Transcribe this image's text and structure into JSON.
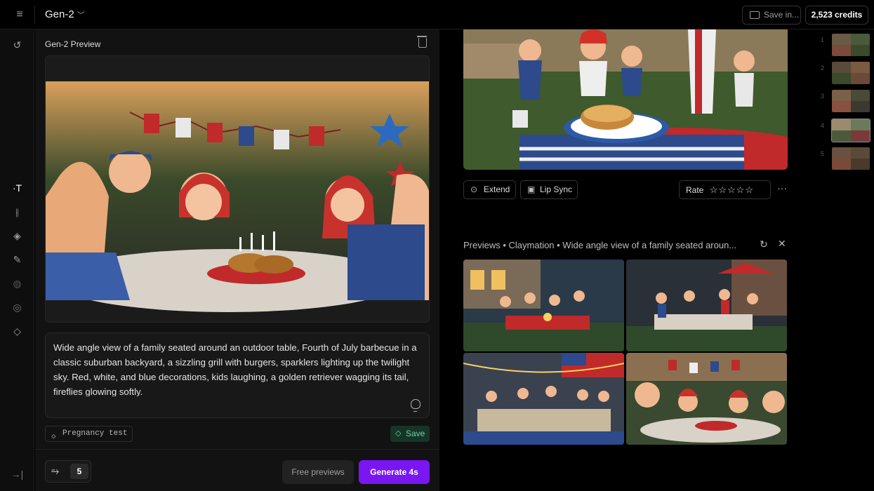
{
  "topbar": {
    "menu_icon": "menu-icon",
    "title": "Gen-2",
    "save_in": "Save in...",
    "credits": "2,523 credits"
  },
  "rail": {
    "icons": [
      "refresh-icon",
      "text-icon",
      "sliders-icon",
      "motion-brush-icon",
      "brush-icon",
      "palette-icon",
      "circle-icon",
      "layers-icon",
      "collapse-panel-icon"
    ]
  },
  "left_panel": {
    "title": "Gen-2 Preview",
    "prompt": "Wide angle view of a family seated around an outdoor table, Fourth of July barbecue in a classic suburban backyard, a sizzling grill with burgers, sparklers lighting up the twilight sky. Red, white, and blue decorations, kids laughing, a golden retriever wagging its tail, fireflies glowing softly.",
    "tag": "Pregnancy test",
    "save_label": "Save",
    "count": "5",
    "free_previews": "Free previews",
    "generate": "Generate 4s"
  },
  "right_panel": {
    "extend_label": "Extend",
    "lipsync_label": "Lip Sync",
    "rate_label": "Rate",
    "stars": "☆☆☆☆☆",
    "more": "···",
    "previews_title": "Previews • Claymation • Wide angle view of a family seated aroun...",
    "refresh_icon": "refresh-icon",
    "close_icon": "close-icon"
  },
  "thumbnails": {
    "numbers": [
      "1",
      "2",
      "3",
      "4",
      "5"
    ]
  },
  "colors": {
    "accent": "#7a16f2",
    "save_green": "#6ed1a0"
  }
}
